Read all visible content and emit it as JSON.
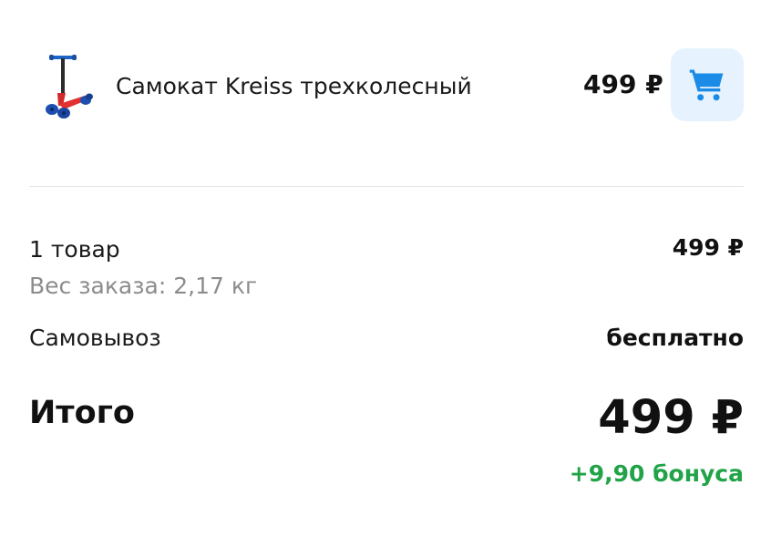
{
  "product": {
    "image_icon": "scooter-image",
    "title": "Самокат Kreiss трехколесный",
    "price": "499 ₽",
    "cart_icon": "cart-icon",
    "cart_button_color": "#e6f2fd",
    "cart_icon_color": "#1a8ce8"
  },
  "summary": {
    "items_label": "1 товар",
    "items_value": "499 ₽",
    "weight_label": "Вес заказа: 2,17 кг",
    "delivery_label": "Самовывоз",
    "delivery_value": "бесплатно",
    "total_label": "Итого",
    "total_value": "499 ₽",
    "bonus": "+9,90 бонуса",
    "bonus_color": "#21a348"
  }
}
